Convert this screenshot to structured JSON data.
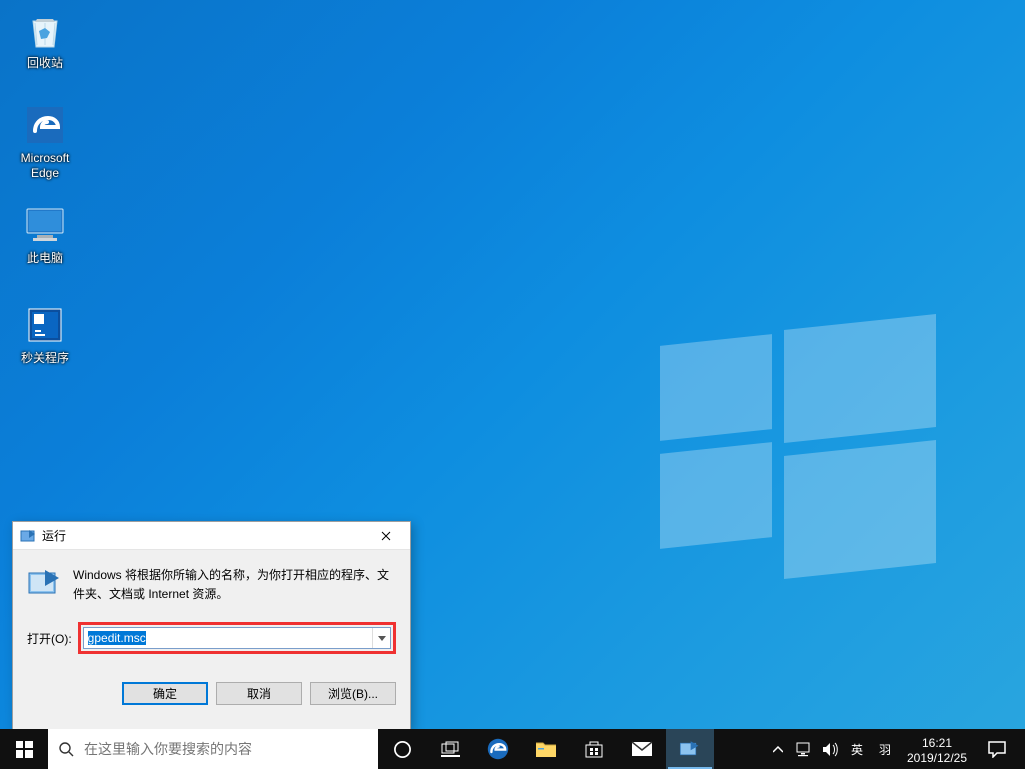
{
  "desktop": {
    "icons": {
      "recycle_bin": "回收站",
      "edge": "Microsoft\nEdge",
      "this_pc": "此电脑",
      "shutdown_app": "秒关程序"
    }
  },
  "run_dialog": {
    "title": "运行",
    "description": "Windows 将根据你所输入的名称，为你打开相应的程序、文件夹、文档或 Internet 资源。",
    "open_label": "打开(O):",
    "input_value": "gpedit.msc",
    "buttons": {
      "ok": "确定",
      "cancel": "取消",
      "browse": "浏览(B)..."
    }
  },
  "taskbar": {
    "search_placeholder": "在这里输入你要搜索的内容",
    "ime1": "英",
    "ime2": "羽",
    "clock": {
      "time": "16:21",
      "date": "2019/12/25"
    }
  }
}
